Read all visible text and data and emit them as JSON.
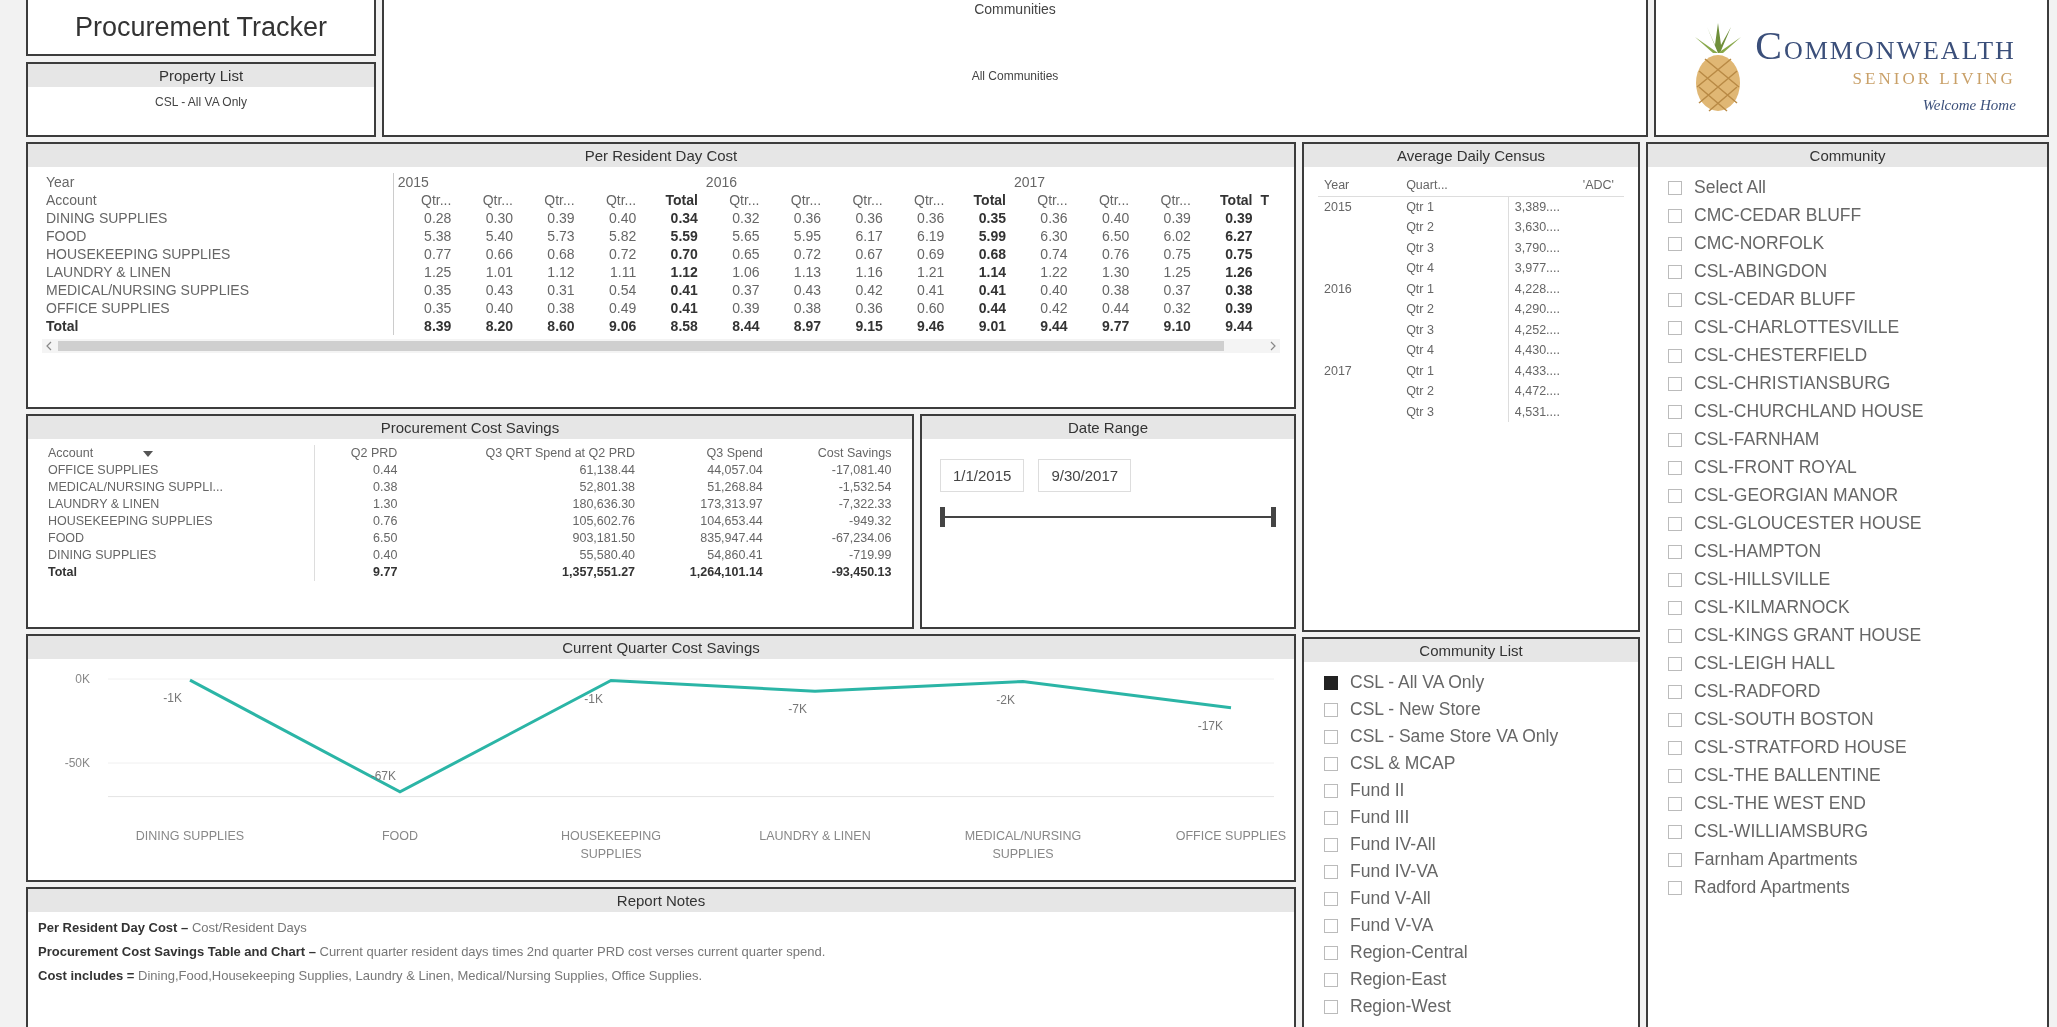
{
  "title": "Procurement Tracker",
  "property_list": {
    "title": "Property List",
    "value": "CSL - All VA Only"
  },
  "communities": {
    "title": "Communities",
    "value": "All Communities"
  },
  "logo": {
    "name": "COMMONWEALTH",
    "subtitle": "SENIOR LIVING",
    "tagline": "Welcome Home"
  },
  "per_resident_day_cost": {
    "title": "Per Resident Day Cost",
    "year_label": "Year",
    "account_label": "Account",
    "columns": [
      {
        "year": "2015",
        "label": "Qtr...",
        "kind": "qtr"
      },
      {
        "label": "Qtr...",
        "kind": "qtr"
      },
      {
        "label": "Qtr...",
        "kind": "qtr"
      },
      {
        "label": "Qtr...",
        "kind": "qtr"
      },
      {
        "label": "Total",
        "kind": "total"
      },
      {
        "year": "2016",
        "label": "Qtr...",
        "kind": "qtr"
      },
      {
        "label": "Qtr...",
        "kind": "qtr"
      },
      {
        "label": "Qtr...",
        "kind": "qtr"
      },
      {
        "label": "Qtr...",
        "kind": "qtr"
      },
      {
        "label": "Total",
        "kind": "total"
      },
      {
        "year": "2017",
        "label": "Qtr...",
        "kind": "qtr"
      },
      {
        "label": "Qtr...",
        "kind": "qtr"
      },
      {
        "label": "Qtr...",
        "kind": "qtr"
      },
      {
        "label": "Total",
        "kind": "total"
      },
      {
        "label": "T",
        "kind": "total"
      }
    ],
    "rows": [
      {
        "account": "DINING SUPPLIES",
        "kind": "data",
        "values": [
          "0.28",
          "0.30",
          "0.39",
          "0.40",
          "0.34",
          "0.32",
          "0.36",
          "0.36",
          "0.36",
          "0.35",
          "0.36",
          "0.40",
          "0.39",
          "0.39"
        ]
      },
      {
        "account": "FOOD",
        "kind": "data",
        "values": [
          "5.38",
          "5.40",
          "5.73",
          "5.82",
          "5.59",
          "5.65",
          "5.95",
          "6.17",
          "6.19",
          "5.99",
          "6.30",
          "6.50",
          "6.02",
          "6.27"
        ]
      },
      {
        "account": "HOUSEKEEPING SUPPLIES",
        "kind": "data",
        "values": [
          "0.77",
          "0.66",
          "0.68",
          "0.72",
          "0.70",
          "0.65",
          "0.72",
          "0.67",
          "0.69",
          "0.68",
          "0.74",
          "0.76",
          "0.75",
          "0.75"
        ]
      },
      {
        "account": "LAUNDRY & LINEN",
        "kind": "data",
        "values": [
          "1.25",
          "1.01",
          "1.12",
          "1.11",
          "1.12",
          "1.06",
          "1.13",
          "1.16",
          "1.21",
          "1.14",
          "1.22",
          "1.30",
          "1.25",
          "1.26"
        ]
      },
      {
        "account": "MEDICAL/NURSING SUPPLIES",
        "kind": "data",
        "values": [
          "0.35",
          "0.43",
          "0.31",
          "0.54",
          "0.41",
          "0.37",
          "0.43",
          "0.42",
          "0.41",
          "0.41",
          "0.40",
          "0.38",
          "0.37",
          "0.38"
        ]
      },
      {
        "account": "OFFICE SUPPLIES",
        "kind": "data",
        "values": [
          "0.35",
          "0.40",
          "0.38",
          "0.49",
          "0.41",
          "0.39",
          "0.38",
          "0.36",
          "0.60",
          "0.44",
          "0.42",
          "0.44",
          "0.32",
          "0.39"
        ]
      },
      {
        "account": "Total",
        "kind": "total",
        "values": [
          "8.39",
          "8.20",
          "8.60",
          "9.06",
          "8.58",
          "8.44",
          "8.97",
          "9.15",
          "9.46",
          "9.01",
          "9.44",
          "9.77",
          "9.10",
          "9.44"
        ]
      }
    ]
  },
  "procurement_cost_savings": {
    "title": "Procurement Cost Savings",
    "columns": [
      "Account",
      "Q2 PRD",
      "Q3 QRT Spend at Q2 PRD",
      "Q3 Spend",
      "Cost Savings"
    ],
    "rows": [
      {
        "kind": "data",
        "cells": [
          "OFFICE SUPPLIES",
          "0.44",
          "61,138.44",
          "44,057.04",
          "-17,081.40"
        ]
      },
      {
        "kind": "data",
        "cells": [
          "MEDICAL/NURSING SUPPLI...",
          "0.38",
          "52,801.38",
          "51,268.84",
          "-1,532.54"
        ]
      },
      {
        "kind": "data",
        "cells": [
          "LAUNDRY & LINEN",
          "1.30",
          "180,636.30",
          "173,313.97",
          "-7,322.33"
        ]
      },
      {
        "kind": "data",
        "cells": [
          "HOUSEKEEPING SUPPLIES",
          "0.76",
          "105,602.76",
          "104,653.44",
          "-949.32"
        ]
      },
      {
        "kind": "data",
        "cells": [
          "FOOD",
          "6.50",
          "903,181.50",
          "835,947.44",
          "-67,234.06"
        ]
      },
      {
        "kind": "data",
        "cells": [
          "DINING SUPPLIES",
          "0.40",
          "55,580.40",
          "54,860.41",
          "-719.99"
        ]
      },
      {
        "kind": "total",
        "cells": [
          "Total",
          "9.77",
          "1,357,551.27",
          "1,264,101.14",
          "-93,450.13"
        ]
      }
    ]
  },
  "date_range": {
    "title": "Date Range",
    "start": "1/1/2015",
    "end": "9/30/2017",
    "level": 1
  },
  "current_quarter_cost_savings": {
    "chart_data": {
      "type": "line",
      "title": "Current Quarter Cost Savings",
      "categories": [
        "DINING SUPPLIES",
        "FOOD",
        "HOUSEKEEPING SUPPLIES",
        "LAUNDRY & LINEN",
        "MEDICAL/NURSING SUPPLIES",
        "OFFICE SUPPLIES"
      ],
      "series": [
        {
          "color": "#2bb5a6",
          "values": [
            -700,
            -67200,
            -900,
            -7300,
            -1500,
            -17100
          ]
        }
      ],
      "ylim": [
        -70000,
        0
      ],
      "yticks": [
        {
          "value": 0,
          "label": "0K"
        },
        {
          "value": -50000,
          "label": "-50K"
        }
      ],
      "value_labels": [
        "-1K",
        "-67K",
        "-1K",
        "-7K",
        "-2K",
        "-17K"
      ]
    }
  },
  "report_notes": {
    "title": "Report Notes",
    "lines": [
      "**Per Resident Day Cost –** Cost/Resident Days",
      "**Procurement Cost Savings Table and Chart –** Current quarter resident days times 2nd quarter PRD cost verses current quarter spend.",
      "**Cost includes =** Dining,Food,Housekeeping Supplies, Laundry & Linen, Medical/Nursing Supplies, Office Supplies."
    ]
  },
  "average_daily_census": {
    "title": "Average Daily Census",
    "columns": [
      "Year",
      "Quart...",
      "'ADC'"
    ],
    "rows": [
      {
        "year": "2015",
        "quarter": "Qtr 1",
        "adc": "3,389...."
      },
      {
        "quarter": "Qtr 2",
        "adc": "3,630...."
      },
      {
        "quarter": "Qtr 3",
        "adc": "3,790...."
      },
      {
        "quarter": "Qtr 4",
        "adc": "3,977...."
      },
      {
        "year": "2016",
        "quarter": "Qtr 1",
        "adc": "4,228...."
      },
      {
        "quarter": "Qtr 2",
        "adc": "4,290...."
      },
      {
        "quarter": "Qtr 3",
        "adc": "4,252...."
      },
      {
        "quarter": "Qtr 4",
        "adc": "4,430...."
      },
      {
        "year": "2017",
        "quarter": "Qtr 1",
        "adc": "4,433...."
      },
      {
        "quarter": "Qtr 2",
        "adc": "4,472...."
      },
      {
        "quarter": "Qtr 3",
        "adc": "4,531...."
      }
    ]
  },
  "community_list": {
    "title": "Community List",
    "items": [
      {
        "label": "CSL - All VA Only",
        "checked": true
      },
      {
        "label": "CSL - New Store",
        "checked": false
      },
      {
        "label": "CSL - Same Store VA Only",
        "checked": false
      },
      {
        "label": "CSL & MCAP",
        "checked": false
      },
      {
        "label": "Fund II",
        "checked": false
      },
      {
        "label": "Fund III",
        "checked": false
      },
      {
        "label": "Fund IV-All",
        "checked": false
      },
      {
        "label": "Fund IV-VA",
        "checked": false
      },
      {
        "label": "Fund V-All",
        "checked": false
      },
      {
        "label": "Fund V-VA",
        "checked": false
      },
      {
        "label": "Region-Central",
        "checked": false
      },
      {
        "label": "Region-East",
        "checked": false
      },
      {
        "label": "Region-West",
        "checked": false
      }
    ]
  },
  "community": {
    "title": "Community",
    "items": [
      {
        "label": "Select All",
        "checked": false
      },
      {
        "label": "CMC-CEDAR BLUFF",
        "checked": false
      },
      {
        "label": "CMC-NORFOLK",
        "checked": false
      },
      {
        "label": "CSL-ABINGDON",
        "checked": false
      },
      {
        "label": "CSL-CEDAR BLUFF",
        "checked": false
      },
      {
        "label": "CSL-CHARLOTTESVILLE",
        "checked": false
      },
      {
        "label": "CSL-CHESTERFIELD",
        "checked": false
      },
      {
        "label": "CSL-CHRISTIANSBURG",
        "checked": false
      },
      {
        "label": "CSL-CHURCHLAND HOUSE",
        "checked": false
      },
      {
        "label": "CSL-FARNHAM",
        "checked": false
      },
      {
        "label": "CSL-FRONT ROYAL",
        "checked": false
      },
      {
        "label": "CSL-GEORGIAN MANOR",
        "checked": false
      },
      {
        "label": "CSL-GLOUCESTER HOUSE",
        "checked": false
      },
      {
        "label": "CSL-HAMPTON",
        "checked": false
      },
      {
        "label": "CSL-HILLSVILLE",
        "checked": false
      },
      {
        "label": "CSL-KILMARNOCK",
        "checked": false
      },
      {
        "label": "CSL-KINGS GRANT HOUSE",
        "checked": false
      },
      {
        "label": "CSL-LEIGH HALL",
        "checked": false
      },
      {
        "label": "CSL-RADFORD",
        "checked": false
      },
      {
        "label": "CSL-SOUTH BOSTON",
        "checked": false
      },
      {
        "label": "CSL-STRATFORD HOUSE",
        "checked": false
      },
      {
        "label": "CSL-THE BALLENTINE",
        "checked": false
      },
      {
        "label": "CSL-THE WEST END",
        "checked": false
      },
      {
        "label": "CSL-WILLIAMSBURG",
        "checked": false
      },
      {
        "label": "Farnham Apartments",
        "checked": false
      },
      {
        "label": "Radford Apartments",
        "checked": false
      }
    ]
  }
}
